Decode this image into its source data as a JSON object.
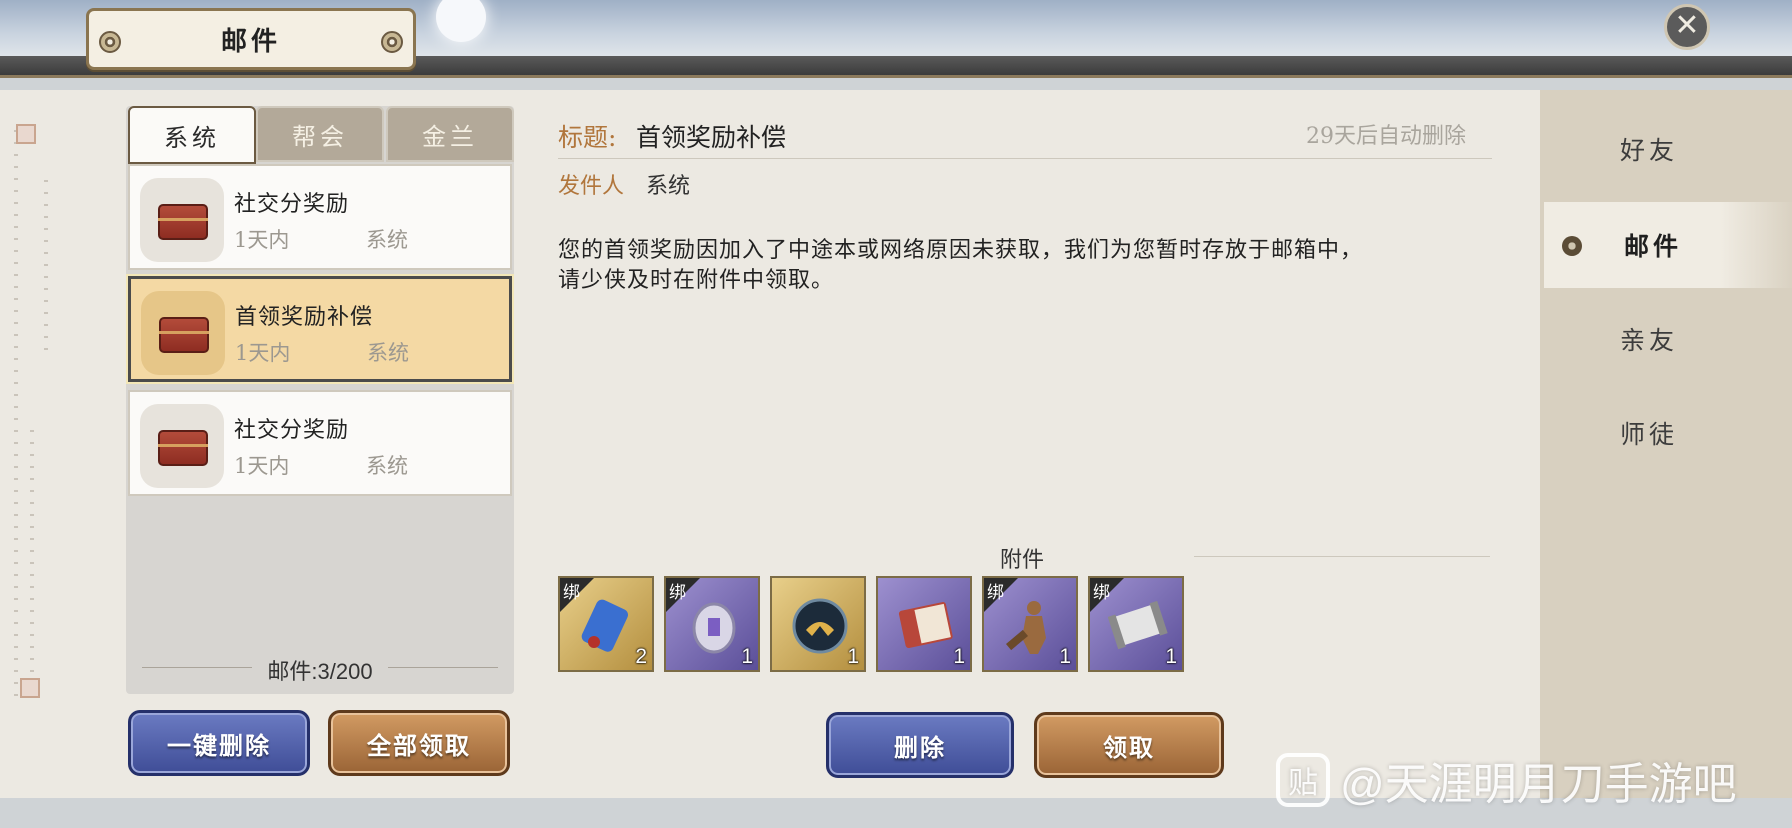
{
  "window": {
    "title": "邮件",
    "close_label": "✕"
  },
  "tabs": [
    {
      "label": "系统",
      "active": true
    },
    {
      "label": "帮会",
      "active": false
    },
    {
      "label": "金兰",
      "active": false
    }
  ],
  "mails": [
    {
      "title": "社交分奖励",
      "time": "1天内",
      "sender": "系统",
      "selected": false
    },
    {
      "title": "首领奖励补偿",
      "time": "1天内",
      "sender": "系统",
      "selected": true
    },
    {
      "title": "社交分奖励",
      "time": "1天内",
      "sender": "系统",
      "selected": false
    }
  ],
  "mail_count": "邮件:3/200",
  "list_buttons": {
    "delete_all": "一键删除",
    "claim_all": "全部领取"
  },
  "detail": {
    "title_label": "标题:",
    "title": "首领奖励补偿",
    "auto_delete": "29天后自动删除",
    "sender_label": "发件人",
    "sender": "系统",
    "body_line1": "您的首领奖励因加入了中途本或网络原因未获取，我们为您暂时存放于邮箱中，",
    "body_line2": "请少侠及时在附件中领取。",
    "attachments_label": "附件",
    "attachments": [
      {
        "name": "blue-scroll-icon",
        "bound": true,
        "bind_label": "绑",
        "qty": "2",
        "frame": "gold",
        "color": "#3a6fd0"
      },
      {
        "name": "silver-token-icon",
        "bound": true,
        "bind_label": "绑",
        "qty": "1",
        "frame": "purple",
        "color": "#d9d6e6"
      },
      {
        "name": "dark-emblem-icon",
        "bound": false,
        "bind_label": "",
        "qty": "1",
        "frame": "gold",
        "color": "#1c2b3a"
      },
      {
        "name": "red-book-icon",
        "bound": false,
        "bind_label": "",
        "qty": "1",
        "frame": "purple",
        "color": "#b8473a"
      },
      {
        "name": "warrior-figure-icon",
        "bound": true,
        "bind_label": "绑",
        "qty": "1",
        "frame": "purple",
        "color": "#9a6a3f"
      },
      {
        "name": "silver-scroll-icon",
        "bound": true,
        "bind_label": "绑",
        "qty": "1",
        "frame": "purple",
        "color": "#cfcfcf"
      }
    ],
    "buttons": {
      "delete": "删除",
      "claim": "领取"
    }
  },
  "right_nav": [
    {
      "label": "好友",
      "active": false
    },
    {
      "label": "邮件",
      "active": true
    },
    {
      "label": "亲友",
      "active": false
    },
    {
      "label": "师徒",
      "active": false
    }
  ],
  "watermark": {
    "logo": "贴",
    "text": "@天涯明月刀手游吧"
  }
}
